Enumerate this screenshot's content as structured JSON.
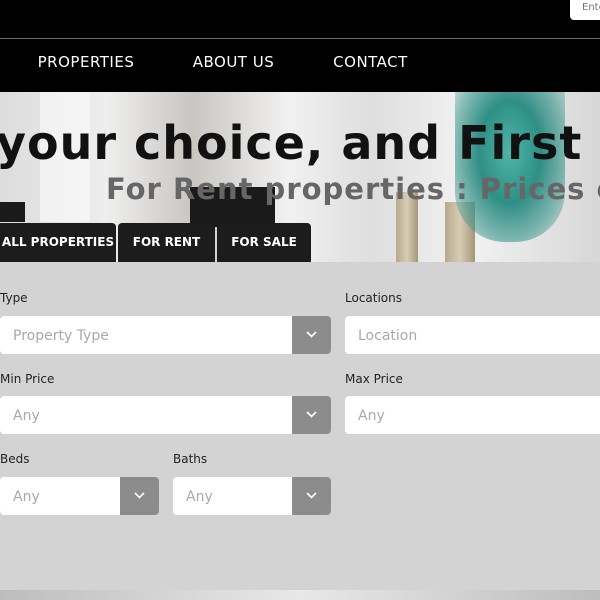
{
  "header": {
    "search_placeholder": "Ente"
  },
  "nav": {
    "items": [
      "PROPERTIES",
      "ABOUT US",
      "CONTACT"
    ]
  },
  "hero": {
    "title": "your choice, and First Riv",
    "subtitle": "For Rent properties : Prices on a"
  },
  "tabs": [
    "ALL PROPERTIES",
    "FOR RENT",
    "FOR SALE"
  ],
  "filters": {
    "type": {
      "label": "Type",
      "placeholder": "Property Type"
    },
    "locations": {
      "label": "Locations",
      "placeholder": "Location"
    },
    "min_price": {
      "label": "Min Price",
      "placeholder": "Any"
    },
    "max_price": {
      "label": "Max Price",
      "placeholder": "Any"
    },
    "beds": {
      "label": "Beds",
      "placeholder": "Any"
    },
    "baths": {
      "label": "Baths",
      "placeholder": "Any"
    }
  },
  "icons": {
    "dropdown": "chevron-down-icon"
  },
  "colors": {
    "nav_bg": "#000000",
    "tab_bg": "#1c1c1c",
    "panel_bg": "#d3d3d3",
    "select_button": "#8c8c8c"
  }
}
